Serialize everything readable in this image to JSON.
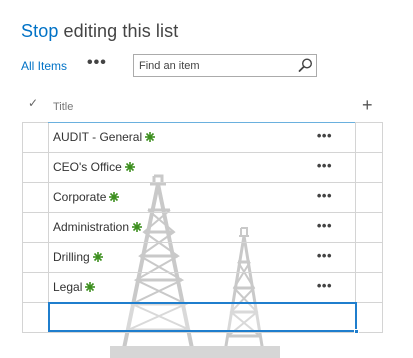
{
  "header": {
    "stop_label": "Stop",
    "rest_label": " editing this list"
  },
  "toolbar": {
    "view_label": "All Items",
    "more_label": "•••",
    "search_placeholder": "Find an item",
    "search_icon": "search-icon"
  },
  "columns": {
    "check_symbol": "✓",
    "title_label": "Title",
    "add_symbol": "+"
  },
  "rows": [
    {
      "title": "AUDIT - General",
      "more": "•••"
    },
    {
      "title": "CEO's Office",
      "more": "•••"
    },
    {
      "title": "Corporate",
      "more": "•••"
    },
    {
      "title": "Administration",
      "more": "•••"
    },
    {
      "title": "Drilling",
      "more": "•••"
    },
    {
      "title": "Legal",
      "more": "•••"
    }
  ],
  "colors": {
    "accent": "#0072c6",
    "new_badge": "#3d8f1f",
    "active_border": "#1f7ecd"
  }
}
